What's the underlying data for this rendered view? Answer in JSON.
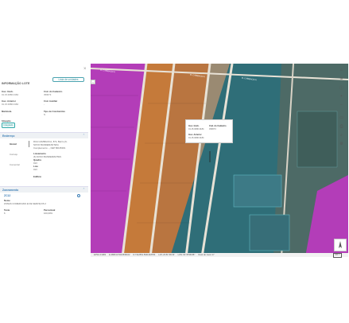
{
  "panel": {
    "title": "INFORMAÇÃO LOTE",
    "units_button": "Lista de unidades",
    "close": "×",
    "fields": [
      {
        "label": "Insc. Imob.",
        "value": "01.15.0080.0184"
      },
      {
        "label": "Cód. do Cadastro",
        "value": "459673"
      },
      {
        "label": "Insc. Anterior",
        "value": "01.15.0080.0184"
      },
      {
        "label": "Cód. Auxiliar",
        "value": "-"
      },
      {
        "label": "Matrícula",
        "value": "-"
      },
      {
        "label": "Tipo de Condomínio",
        "value": "N"
      }
    ],
    "situacao_label": "Situação",
    "situacao_value": "Integrado",
    "endereco": {
      "title": "Endereço",
      "rows": [
        {
          "tab": "Imóvel",
          "lines": [
            "RUA CAMBACICA, 874, Bairro (6-",
            "NOVO BANDEIRANTES)",
            "Complemento: -, CEP 86135001"
          ]
        },
        {
          "tab": "Corresp.",
          "lines": [
            "Loteamento",
            "(6) NOVO BANDEIRANTES"
          ]
        },
        {
          "tab": "Comercial",
          "lines": [
            "Quadra",
            "013",
            "Lote",
            "013",
            "Edifício"
          ]
        }
      ]
    },
    "zoneamento": {
      "title": "Zoneamento",
      "code": "ZC12",
      "nome_label": "Nome",
      "nome_value": "ZONAS COMERCIAIS E DE SERVIÇOS 2",
      "testa_label": "Testa",
      "testa_value": "6",
      "percentual_label": "Percentual",
      "percentual_value": "100,00%"
    }
  },
  "popup": {
    "fields": [
      {
        "label": "Insc. Imob.",
        "value": "01.15.0080.0184"
      },
      {
        "label": "Cód. do Cadastro",
        "value": "459673"
      },
      {
        "label": "Insc. Anterior",
        "value": "01.15.0080.0184"
      }
    ]
  },
  "street_labels": [
    "R. CAMBACICA",
    "R. CAMBACICA",
    "R. CAMBACICA"
  ],
  "status_bar": [
    "EPSG:31982",
    "E:488313.5313536162",
    "N:7412551.5941318784",
    "LAT:-23.51°48.33'",
    "LON:-51°25'08.88''",
    "Nível de zoom:17"
  ],
  "scale_text": "100 m",
  "tools": [
    "home-icon",
    "layers-icon",
    "info-icon",
    "plus-icon",
    "minus-icon",
    "measure-icon",
    "print-icon",
    "search-icon",
    "settings-icon"
  ],
  "colors": {
    "accent": "#3a7db5",
    "parcel_magenta": "#c23ec5",
    "selection_teal": "#3bb3c2"
  }
}
